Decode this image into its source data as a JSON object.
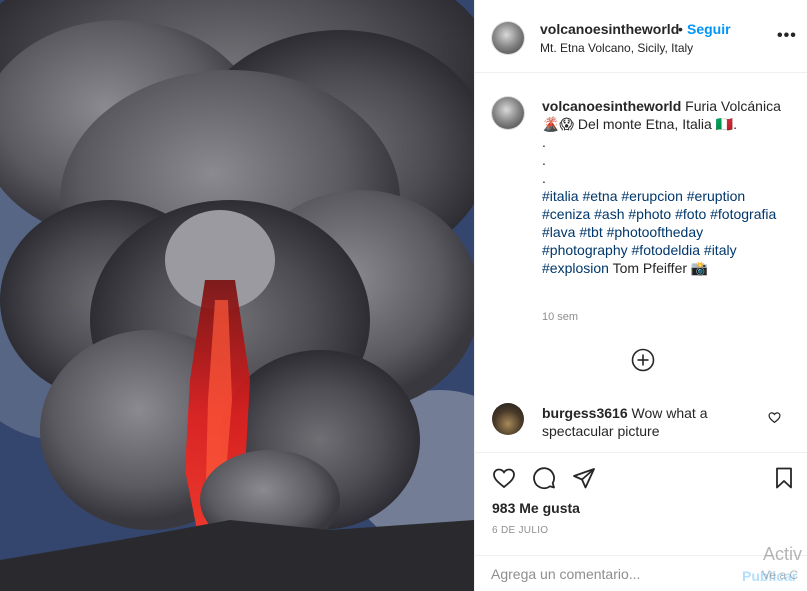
{
  "post": {
    "username": "volcanoesintheworld",
    "separator": "•",
    "follow_label": "Seguir",
    "location": "Mt. Etna Volcano, Sicily, Italy",
    "more_label": "•••",
    "image_icon": "volcano-eruption-photo"
  },
  "caption": {
    "username": "volcanoesintheworld",
    "line1": "Furia Volcánica",
    "line2": "🌋😱 Del monte Etna, Italia 🇮🇹.",
    "dot1": ".",
    "dot2": ".",
    "dot3": ".",
    "hashtags": "#italia #etna #erupcion #eruption #ceniza #ash #photo #foto #fotografia #lava #tbt #photooftheday #photography #fotodeldia #italy #explosion",
    "credit": "Tom Pfeiffer 📸",
    "time": "10 sem"
  },
  "comments": {
    "load_more_icon": "plus-circle-icon",
    "items": [
      {
        "username": "burgess3616",
        "text": "Wow what a spectacular picture"
      }
    ]
  },
  "actions": {
    "like_icon": "heart-icon",
    "comment_icon": "comment-icon",
    "share_icon": "paper-plane-icon",
    "save_icon": "bookmark-icon",
    "likes_text": "983 Me gusta",
    "date": "6 DE JULIO"
  },
  "composer": {
    "placeholder": "Agrega un comentario...",
    "publish_label": "Publicar"
  },
  "overlay": {
    "windows_activate": "Activ",
    "windows_activate_sub": "Ve a C"
  }
}
